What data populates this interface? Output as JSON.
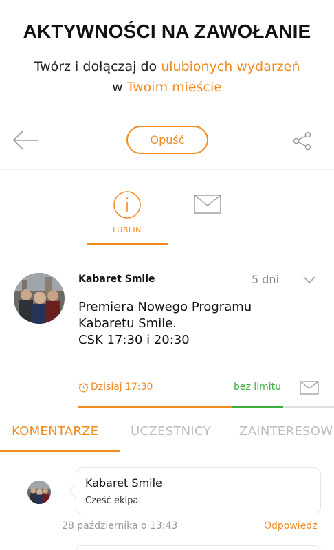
{
  "promo": {
    "title": "AKTYWNOŚCI NA ZAWOŁANIE",
    "line1_prefix": "Twórz i dołączaj do ",
    "line1_accent": "ulubionych wydarzeń",
    "line2_prefix": "w ",
    "line2_accent": "Twoim mieście"
  },
  "toolbar": {
    "back_icon": "arrow-left-icon",
    "leave_label": "Opuść",
    "share_icon": "share-icon"
  },
  "top_tabs": {
    "info_label": "LUBLIN",
    "info_icon": "info-circle-icon",
    "mail_icon": "envelope-icon"
  },
  "post": {
    "author": "Kabaret Smile",
    "age": "5 dni",
    "line1": "Premiera Nowego Programu",
    "line2": "Kabaretu Smile.",
    "line3": "CSK 17:30 i 20:30",
    "time_label": "Dzisiaj 17:30",
    "limit_label": "bez limitu"
  },
  "tabs": [
    {
      "label": "KOMENTARZE",
      "active": true
    },
    {
      "label": "UCZESTNICY",
      "active": false
    },
    {
      "label": "ZAINTERESOW",
      "active": false
    }
  ],
  "comments": [
    {
      "author": "Kabaret Smile",
      "text": "Cześć ekipa.",
      "date": "28 października o 13:43",
      "reply_label": "Odpowiedz"
    }
  ],
  "colors": {
    "accent": "#f28a1e",
    "green": "#3cae3f",
    "muted": "#bdbdbd"
  }
}
